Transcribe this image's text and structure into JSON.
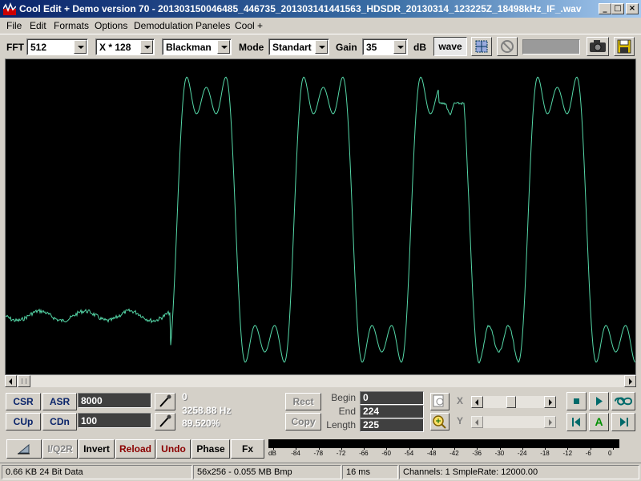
{
  "window": {
    "title": "Cool Edit + Demo version 70 - 201303150046485_446735_201303141441563_HDSDR_20130314_123225Z_18498kHz_IF_.wav",
    "buttons": {
      "minimize": "_",
      "maximize": "□",
      "close": "×"
    }
  },
  "menu": [
    "File",
    "Edit",
    "Formats",
    "Options",
    "Demodulation",
    "Paneles",
    "Cool +"
  ],
  "toolbar": {
    "fft_label": "FFT",
    "fft_value": "512",
    "scale_value": "X * 128",
    "window_value": "Blackman",
    "mode_label": "Mode",
    "mode_value": "Standart",
    "gain_label": "Gain",
    "gain_value": "35",
    "db_label": "dB",
    "wave_label": "wave"
  },
  "panel": {
    "csr": "CSR",
    "asr": "ASR",
    "asr_value": "8000",
    "cup": "CUp",
    "cdn": "CDn",
    "cdn_value": "100",
    "cursor_value": "0",
    "frequency": "3258.88 Hz",
    "percent": "89.520%",
    "rect": "Rect",
    "copy": "Copy",
    "begin_label": "Begin",
    "begin_value": "0",
    "end_label": "End",
    "end_value": "224",
    "length_label": "Length",
    "length_value": "225",
    "x_label": "X",
    "y_label": "Y"
  },
  "bottom": {
    "iq2r": "I/Q2R",
    "invert": "Invert",
    "reload": "Reload",
    "undo": "Undo",
    "phase": "Phase",
    "fx": "Fx",
    "db_scale": [
      "dB",
      "-84",
      "-78",
      "-72",
      "-66",
      "-60",
      "-54",
      "-48",
      "-42",
      "-36",
      "-30",
      "-24",
      "-18",
      "-12",
      "-6",
      "0"
    ]
  },
  "status": {
    "size": "0.66 KB 24 Bit Data",
    "bitmap": "56x256 - 0.055 MB Bmp",
    "time": "16 ms",
    "channels": "Channels: 1  SmpleRate: 12000.00"
  },
  "colors": {
    "wave": "#55d8a8",
    "title_start": "#0a246a",
    "title_end": "#a6caf0"
  }
}
